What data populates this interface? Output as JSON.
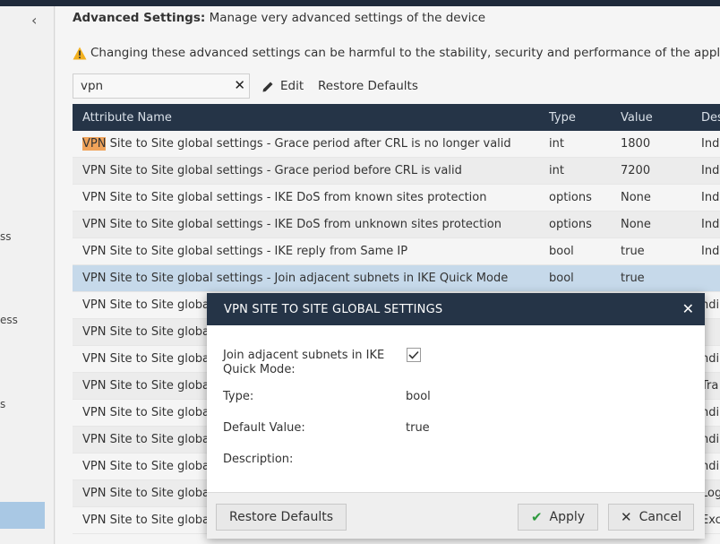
{
  "sidebar": {
    "fragments": [
      "ss",
      "ess",
      "s"
    ]
  },
  "header": {
    "title_bold": "Advanced Settings:",
    "title_rest": " Manage very advanced settings of the device",
    "warning": "Changing these advanced settings can be harmful to the stability, security and performance of the appliance"
  },
  "toolbar": {
    "search_value": "vpn",
    "edit_label": "Edit",
    "restore_label": "Restore Defaults"
  },
  "table": {
    "columns": [
      "Attribute Name",
      "Type",
      "Value",
      "Des"
    ],
    "rows": [
      {
        "prefix": "VPN",
        "name": " Site to Site global settings - Grace period after CRL is no longer valid",
        "type": "int",
        "value": "1800",
        "desc": "Indi"
      },
      {
        "prefix": "",
        "name": "VPN Site to Site global settings - Grace period before CRL is valid",
        "type": "int",
        "value": "7200",
        "desc": "Indi"
      },
      {
        "prefix": "",
        "name": "VPN Site to Site global settings - IKE DoS from known sites protection",
        "type": "options",
        "value": "None",
        "desc": "Indi"
      },
      {
        "prefix": "",
        "name": "VPN Site to Site global settings - IKE DoS from unknown sites protection",
        "type": "options",
        "value": "None",
        "desc": "Indi"
      },
      {
        "prefix": "",
        "name": "VPN Site to Site global settings - IKE reply from Same IP",
        "type": "bool",
        "value": "true",
        "desc": "Indi"
      },
      {
        "prefix": "",
        "name": "VPN Site to Site global settings - Join adjacent subnets in IKE Quick Mode",
        "type": "bool",
        "value": "true",
        "desc": ""
      },
      {
        "prefix": "",
        "name": "VPN Site to Site global s",
        "type": "",
        "value": "",
        "desc": "ndi"
      },
      {
        "prefix": "",
        "name": "VPN Site to Site global s",
        "type": "",
        "value": "",
        "desc": ""
      },
      {
        "prefix": "",
        "name": "VPN Site to Site global s",
        "type": "",
        "value": "",
        "desc": "ndi"
      },
      {
        "prefix": "",
        "name": "VPN Site to Site global s",
        "type": "",
        "value": "",
        "desc": "Tra"
      },
      {
        "prefix": "",
        "name": "VPN Site to Site global s",
        "type": "",
        "value": "",
        "desc": "ndi"
      },
      {
        "prefix": "",
        "name": "VPN Site to Site global s",
        "type": "",
        "value": "",
        "desc": "ndi"
      },
      {
        "prefix": "",
        "name": "VPN Site to Site global s",
        "type": "",
        "value": "",
        "desc": "ndi"
      },
      {
        "prefix": "",
        "name": "VPN Site to Site global s",
        "type": "",
        "value": "",
        "desc": "Log"
      },
      {
        "prefix": "",
        "name": "VPN Site to Site global s",
        "type": "",
        "value": "",
        "desc": "Exc"
      }
    ]
  },
  "dialog": {
    "title": "VPN SITE TO SITE GLOBAL SETTINGS",
    "field_label": "Join adjacent subnets in IKE Quick Mode:",
    "type_label": "Type:",
    "type_value": "bool",
    "default_label": "Default Value:",
    "default_value": "true",
    "description_label": "Description:",
    "restore_label": "Restore Defaults",
    "apply_label": "Apply",
    "cancel_label": "Cancel"
  },
  "colors": {
    "header_bg": "#253447",
    "selected_row": "#c6d9ea",
    "highlight": "#f0a35a",
    "apply_check": "#2e9a3e"
  }
}
